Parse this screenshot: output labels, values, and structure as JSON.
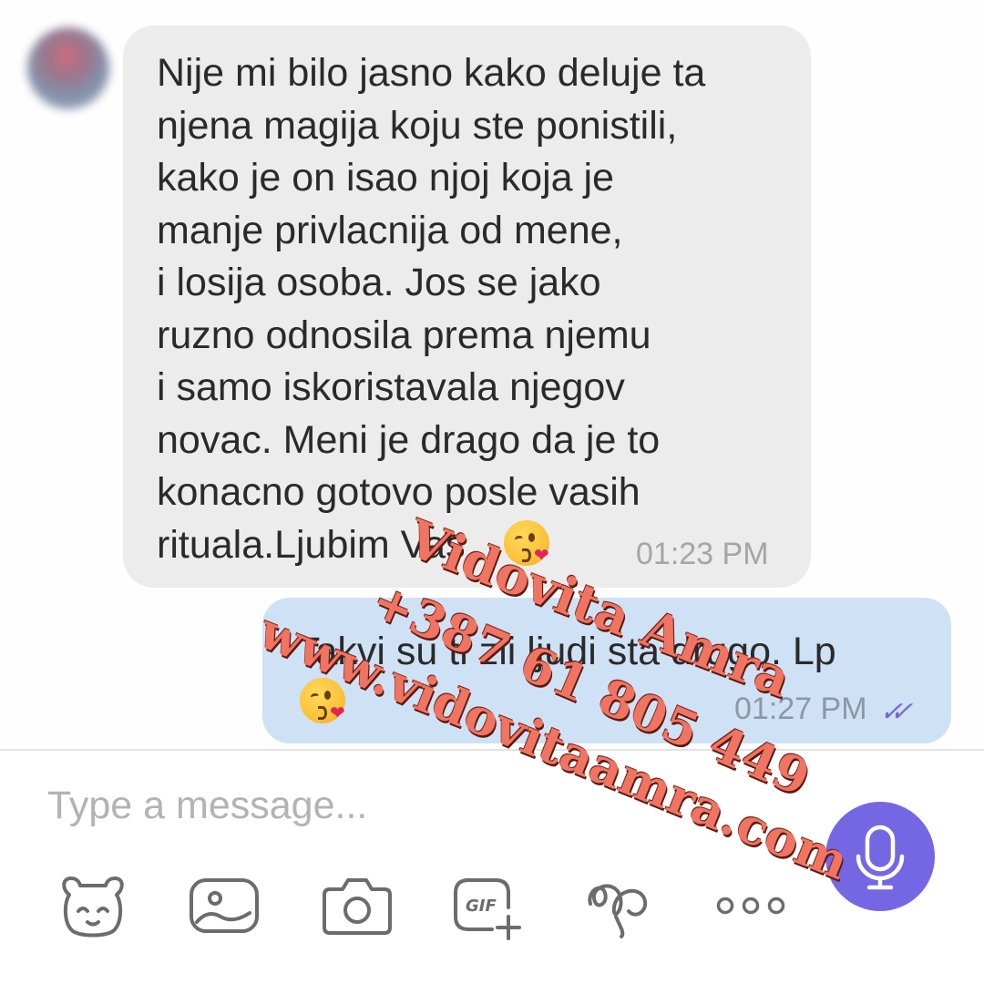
{
  "conversation": {
    "incoming": {
      "text": "Nije mi bilo jasno kako deluje ta\nnjena magija koju ste ponistili,\nkako je on isao njoj koja je\nmanje privlacnija od mene,\ni losija osoba. Jos se jako\nruzno odnosila prema njemu\ni samo iskoristavala njegov\nnovac. Meni je drago da je to\nkonacno gotovo posle vasih\nrituala.Ljubim Vas",
      "emoji": "kissing-heart-emoji",
      "time": "01:23 PM"
    },
    "outgoing": {
      "text": "Takvi su ti zli ljudi sta drugo. Lp",
      "emoji": "kissing-heart-emoji",
      "time": "01:27 PM",
      "status_icon": "double-check-icon",
      "status_color": "#7866d6"
    }
  },
  "composer": {
    "placeholder": "Type a message...",
    "toolbar_icons": [
      "sticker-icon",
      "gallery-icon",
      "camera-icon",
      "gif-icon",
      "doodle-icon",
      "more-icon"
    ],
    "mic_icon": "microphone-icon",
    "accent_color": "#7567e4"
  },
  "watermark": {
    "name": "Vidovita Amra",
    "phone": "+387 61 805 449",
    "website": "www.vidovitaamra.com",
    "color": "#f07462"
  }
}
